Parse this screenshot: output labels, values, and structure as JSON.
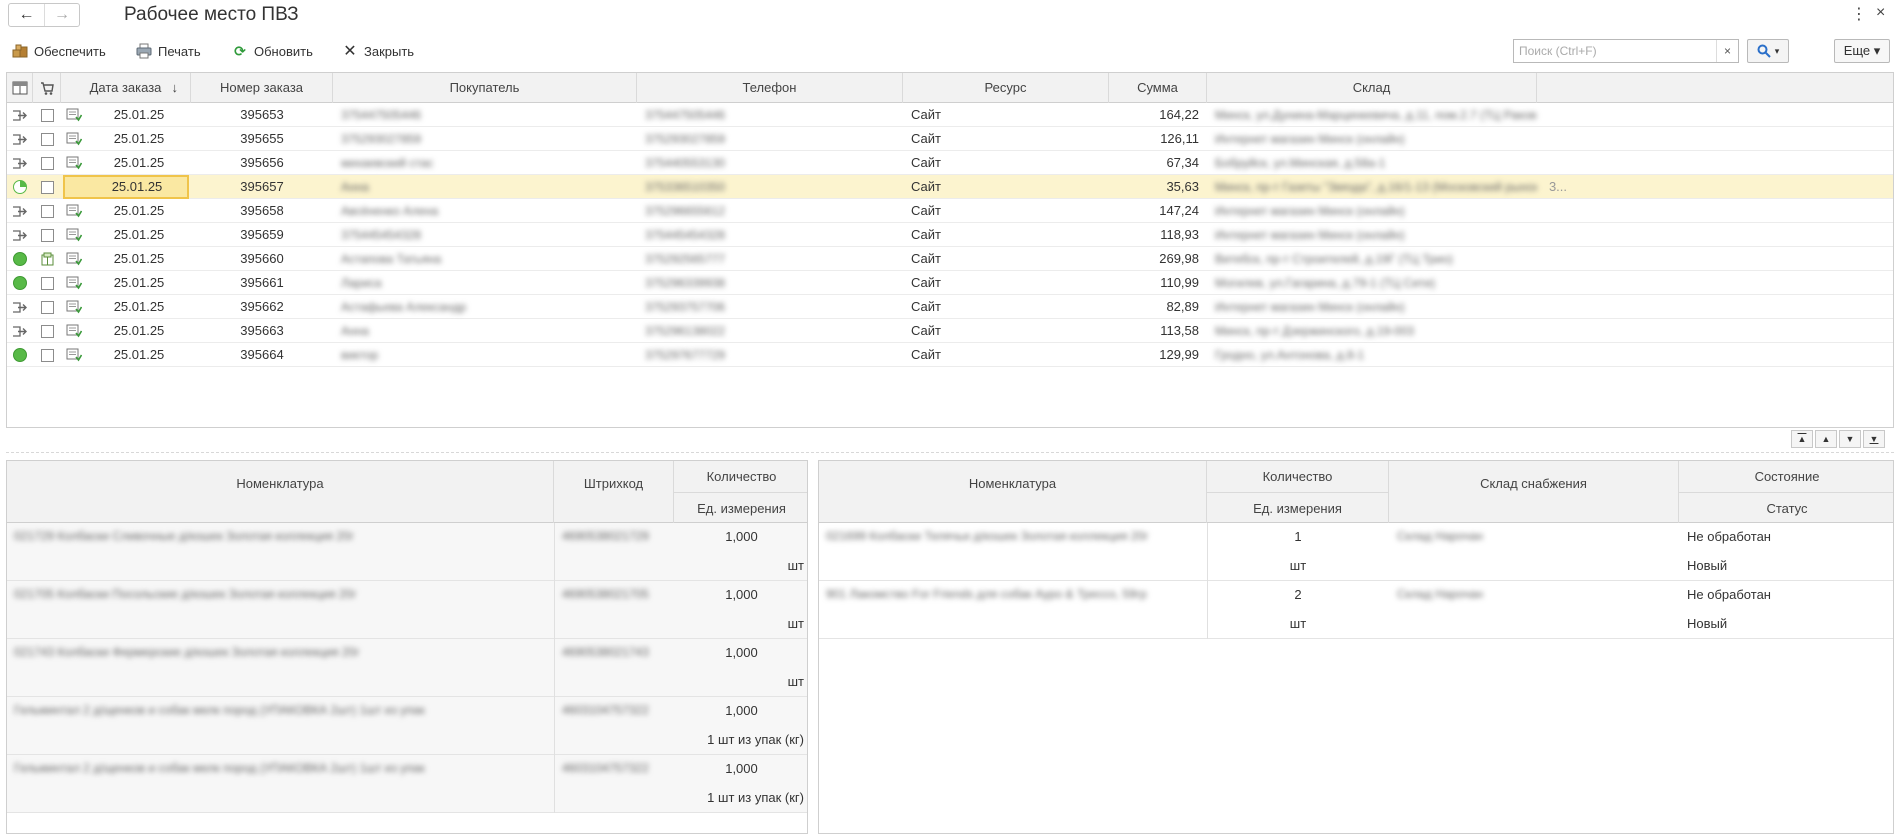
{
  "window": {
    "title": "Рабочее место ПВЗ",
    "back_label": "←",
    "forward_label": "→",
    "menu_label": "⋮",
    "close_label": "×"
  },
  "toolbar": {
    "provide_label": "Обеспечить",
    "print_label": "Печать",
    "refresh_label": "Обновить",
    "close_label": "Закрыть",
    "search_placeholder": "Поиск (Ctrl+F)",
    "search_clear": "×",
    "more_label": "Еще ▾"
  },
  "orders": {
    "columns": {
      "date": "Дата заказа",
      "sort_indicator": "↓",
      "number": "Номер заказа",
      "customer": "Покупатель",
      "phone": "Телефон",
      "resource": "Ресурс",
      "sum": "Сумма",
      "warehouse": "Склад"
    },
    "rows": [
      {
        "status": "arrow",
        "checked": false,
        "date": "25.01.25",
        "number": "395653",
        "customer": "375447505446",
        "phone": "375447505446",
        "resource": "Сайт",
        "sum": "164,22",
        "warehouse": "Минск, ул.Дунина-Марцинкевича, д.11, пом.2.7 (ТЦ Раковск..."
      },
      {
        "status": "arrow",
        "checked": false,
        "date": "25.01.25",
        "number": "395655",
        "customer": "375293027859",
        "phone": "375293027859",
        "resource": "Сайт",
        "sum": "126,11",
        "warehouse": "Интернет магазин Минск (онлайн)"
      },
      {
        "status": "arrow",
        "checked": false,
        "date": "25.01.25",
        "number": "395656",
        "customer": "михаевский стас",
        "phone": "375440553130",
        "resource": "Сайт",
        "sum": "67,34",
        "warehouse": "Бобруйск, ул.Минская, д.58а-1"
      },
      {
        "status": "pending",
        "checked": false,
        "date": "25.01.25",
        "number": "395657",
        "customer": "Анна",
        "phone": "375336510350",
        "resource": "Сайт",
        "sum": "35,63",
        "warehouse": "Минск, пр-т Газеты \"Звязда\", д.16/1-13 (Московский рынок) (...",
        "extra": "3...",
        "selected": true
      },
      {
        "status": "arrow",
        "checked": false,
        "date": "25.01.25",
        "number": "395658",
        "customer": "Авсёненко Алена",
        "phone": "375296655612",
        "resource": "Сайт",
        "sum": "147,24",
        "warehouse": "Интернет магазин Минск (онлайн)"
      },
      {
        "status": "arrow",
        "checked": false,
        "date": "25.01.25",
        "number": "395659",
        "customer": "375445454328",
        "phone": "375445454328",
        "resource": "Сайт",
        "sum": "118,93",
        "warehouse": "Интернет магазин Минск (онлайн)"
      },
      {
        "status": "green",
        "checked": true,
        "date": "25.01.25",
        "number": "395660",
        "customer": "Астапова Татьяна",
        "phone": "375292565777",
        "resource": "Сайт",
        "sum": "269,98",
        "warehouse": "Витебск, пр-т Строителей, д.19Г (ТЦ Трио)"
      },
      {
        "status": "green",
        "checked": false,
        "date": "25.01.25",
        "number": "395661",
        "customer": "Лариса",
        "phone": "375296339938",
        "resource": "Сайт",
        "sum": "110,99",
        "warehouse": "Могилев, ул.Гагарина, д.79-1 (ТЦ Сити)"
      },
      {
        "status": "arrow",
        "checked": false,
        "date": "25.01.25",
        "number": "395662",
        "customer": "Астафьева Александр",
        "phone": "375293757706",
        "resource": "Сайт",
        "sum": "82,89",
        "warehouse": "Интернет магазин Минск (онлайн)"
      },
      {
        "status": "arrow",
        "checked": false,
        "date": "25.01.25",
        "number": "395663",
        "customer": "Анна",
        "phone": "375296138022",
        "resource": "Сайт",
        "sum": "113,58",
        "warehouse": "Минск, пр-т Дзержинского, д.19-003"
      },
      {
        "status": "green",
        "checked": false,
        "date": "25.01.25",
        "number": "395664",
        "customer": "виктор",
        "phone": "375297677729",
        "resource": "Сайт",
        "sum": "129,99",
        "warehouse": "Гродно, ул.Антонова, д.8-1"
      }
    ]
  },
  "goods": {
    "columns": {
      "nomenclature": "Номенклатура",
      "barcode": "Штрихкод",
      "quantity": "Количество",
      "unit": "Ед. измерения"
    },
    "rows": [
      {
        "name": "021729 Колбаски Сливочные д/кошек Золотая коллекция 20г",
        "barcode": "4690538021729",
        "quantity": "1,000",
        "unit": "шт"
      },
      {
        "name": "021705 Колбаски Посольские д/кошек Золотая коллекция 20г",
        "barcode": "4690538021705",
        "quantity": "1,000",
        "unit": "шт"
      },
      {
        "name": "021743 Колбаски Фермерские д/кошек Золотая коллекция 20г",
        "barcode": "4690538021743",
        "quantity": "1,000",
        "unit": "шт"
      },
      {
        "name": "Гельминтал 2 д/щенков и собак мелк пород (УПАКОВКА 2шт) 1шт из упак",
        "barcode": "4603104757322",
        "quantity": "1,000",
        "unit": "1 шт из упак (кг)"
      },
      {
        "name": "Гельминтал 2 д/щенков и собак мелк пород (УПАКОВКА 2шт) 1шт из упак",
        "barcode": "4603104757322",
        "quantity": "1,000",
        "unit": "1 шт из упак (кг)"
      }
    ]
  },
  "supply": {
    "columns": {
      "nomenclature": "Номенклатура",
      "quantity": "Количество",
      "unit": "Ед. измерения",
      "warehouse": "Склад снабжения",
      "state": "Состояние",
      "status": "Статус"
    },
    "rows": [
      {
        "name": "021699 Колбаски Телячьи д/кошек Золотая коллекция 20г",
        "quantity": "1",
        "unit": "шт",
        "warehouse": "Склад Нарочан",
        "state": "Не обработан",
        "status": "Новый"
      },
      {
        "name": "901 Лакомство For Friends для собак Ауро & Трессо, 59гр",
        "quantity": "2",
        "unit": "шт",
        "warehouse": "Склад Нарочан",
        "state": "Не обработан",
        "status": "Новый"
      }
    ]
  },
  "pager": {
    "first": "▲",
    "up": "▲",
    "down": "▼",
    "last": "▼"
  }
}
